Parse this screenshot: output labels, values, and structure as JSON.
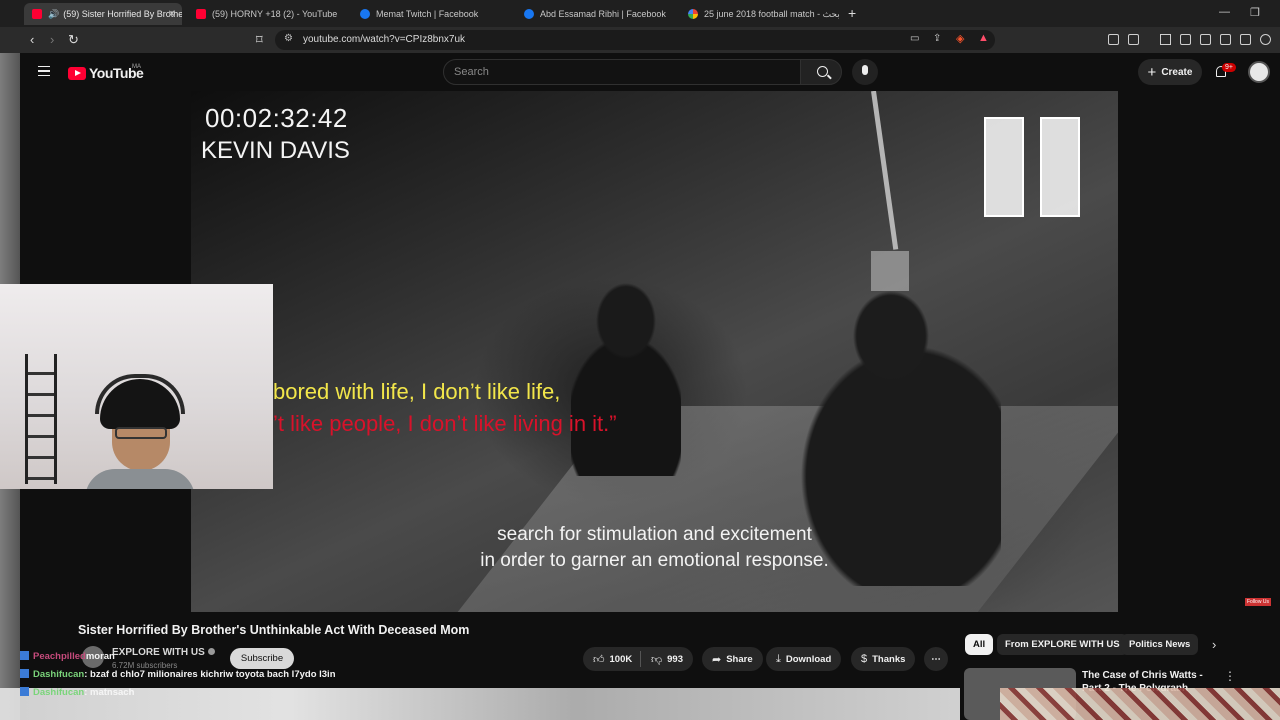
{
  "browser": {
    "tabs": [
      {
        "label": "(59) Sister Horrified By Brothe",
        "favicon": "youtube-icon"
      },
      {
        "label": "(59) HORNY +18 (2) - YouTube",
        "favicon": "youtube-icon"
      },
      {
        "label": "Memat Twitch | Facebook",
        "favicon": "facebook-icon"
      },
      {
        "label": "Abd Essamad Ribhi | Facebook",
        "favicon": "facebook-icon"
      },
      {
        "label": "25 june 2018 football match - بحث G",
        "favicon": "google-icon"
      }
    ],
    "new_tab": "+",
    "url": "youtube.com/watch?v=CPIz8bnx7uk"
  },
  "youtube": {
    "logo_text": "YouTube",
    "country": "MA",
    "search_placeholder": "Search",
    "create_label": "Create",
    "notification_count": "9+"
  },
  "video": {
    "timecode": "00:02:32:42",
    "person_name": "KEVIN DAVIS",
    "quote_line1": "bored with life, I don’t like life,",
    "quote_line2": "’t like people, I don’t like living in it.”",
    "caption_line1": "search for stimulation and excitement",
    "caption_line2": "in order to garner an emotional response.",
    "corner_badge": "Follow Us"
  },
  "watch": {
    "title": "Sister Horrified By Brother's Unthinkable Act With Deceased Mom",
    "channel": "EXPLORE WITH US",
    "subscribers": "6.72M subscribers",
    "subscribe_label": "Subscribe",
    "likes": "100K",
    "dislikes": "993",
    "share_label": "Share",
    "download_label": "Download",
    "thanks_label": "Thanks",
    "more_label": "⋯"
  },
  "chat": [
    {
      "user": "Peachpilled",
      "msg": "moran"
    },
    {
      "user": "Dashifucan",
      "msg": ": bzaf d chlo7 milionaires kichriw toyota bach l7ydo l3in"
    },
    {
      "user": "Dashifucan",
      "msg": ": matnsach"
    }
  ],
  "sidebar": {
    "chips": [
      "All",
      "From EXPLORE WITH US",
      "Politics News"
    ],
    "rec_title": "The Case of Chris Watts - Part 2 - The Polygraph"
  }
}
